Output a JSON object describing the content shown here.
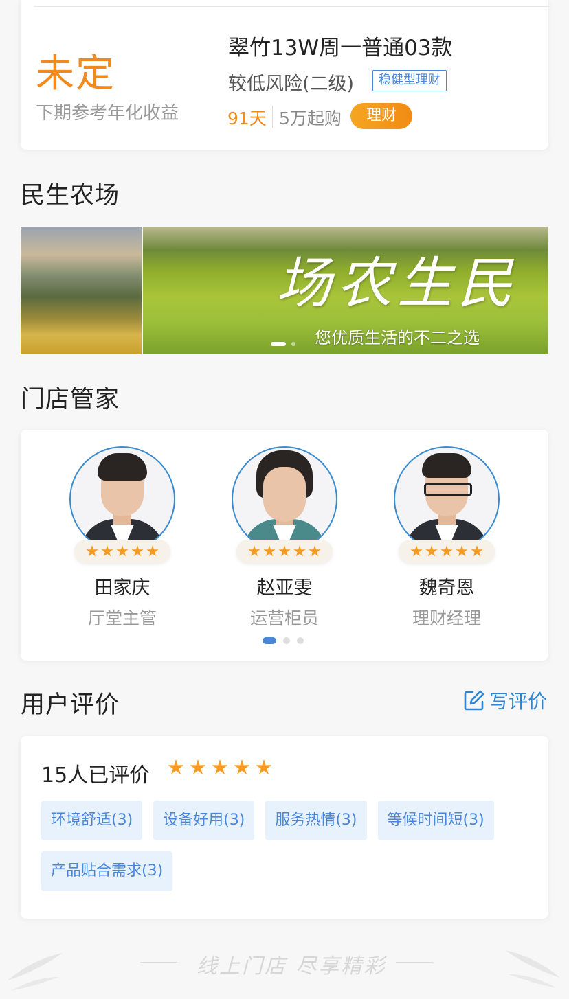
{
  "product": {
    "rate": "未定",
    "rate_label": "下期参考年化收益",
    "title": "翠竹13W周一普通03款",
    "risk": "较低风险(二级)",
    "tag": "稳健型理财",
    "days": "91天",
    "min_purchase": "5万起购",
    "button": "理财"
  },
  "farm": {
    "title": "民生农场",
    "banner_calligraphy": "场农生民",
    "banner_subtitle": "您优质生活的不二之选"
  },
  "staff_section": {
    "title": "门店管家",
    "staff": [
      {
        "name": "田家庆",
        "role": "厅堂主管",
        "rating": 5
      },
      {
        "name": "赵亚雯",
        "role": "运营柜员",
        "rating": 5
      },
      {
        "name": "魏奇恩",
        "role": "理财经理",
        "rating": 5
      }
    ]
  },
  "reviews": {
    "title": "用户评价",
    "write_label": "写评价",
    "count_text": "15人已评价",
    "rating": 5,
    "tags": [
      "环境舒适(3)",
      "设备好用(3)",
      "服务热情(3)",
      "等候时间短(3)",
      "产品贴合需求(3)"
    ]
  },
  "footer": {
    "slogan": "线上门店  尽享精彩"
  },
  "colors": {
    "accent_orange": "#f08a1c",
    "accent_blue": "#4a86d9"
  }
}
